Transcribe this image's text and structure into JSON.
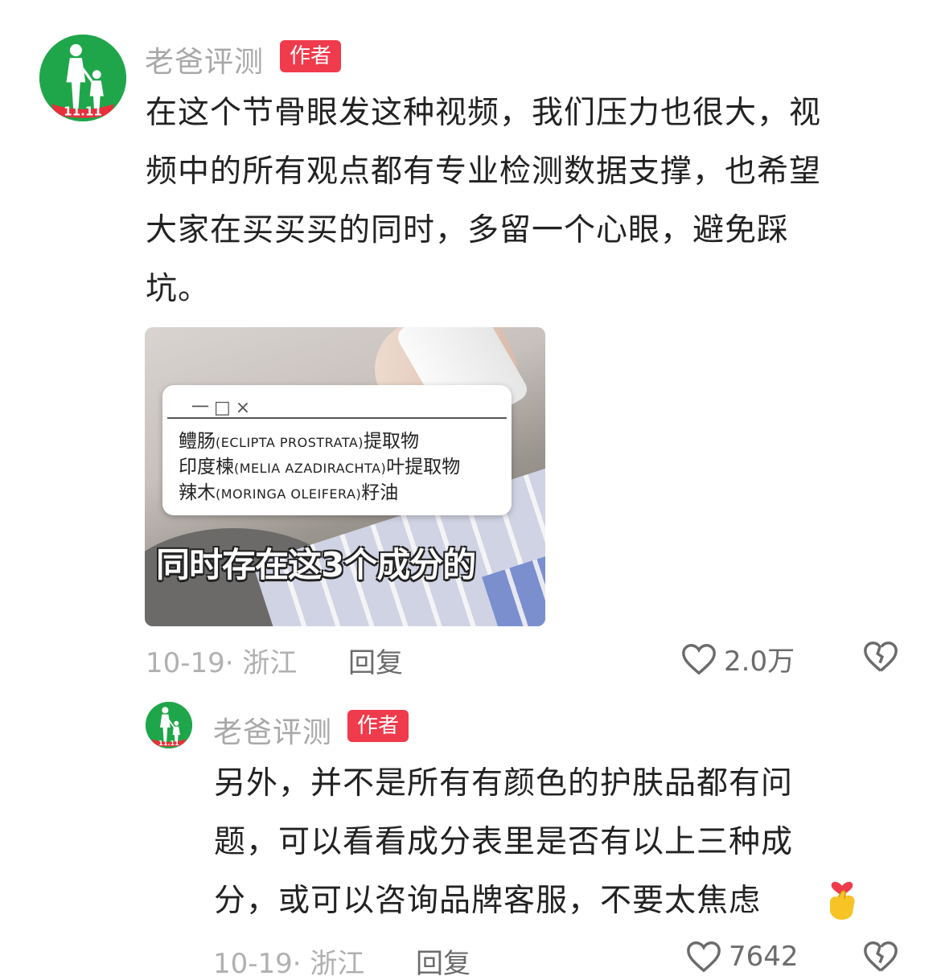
{
  "comment": {
    "username": "老爸评测",
    "badge": "作者",
    "avatar_badge": "11.11",
    "text_lines": [
      "在这个节骨眼发这种视频，我们压力也很大，视",
      "频中的所有观点都有专业检测数据支撑，也希望",
      "大家在买买买的同时，多留一个心眼，避免踩",
      "坑。"
    ],
    "image": {
      "window_controls": "一□×",
      "ingredients": [
        {
          "cn": "鳢肠",
          "latin": "(ECLIPTA PROSTRATA)",
          "suffix": "提取物"
        },
        {
          "cn": "印度楝",
          "latin": "(MELIA AZADIRACHTA)",
          "suffix": "叶提取物"
        },
        {
          "cn": "辣木",
          "latin": "(MORINGA OLEIFERA)",
          "suffix": "籽油"
        }
      ],
      "caption": "同时存在这3个成分的"
    },
    "date_location": "10-19· 浙江",
    "reply_label": "回复",
    "likes": "2.0万"
  },
  "reply": {
    "username": "老爸评测",
    "badge": "作者",
    "avatar_badge": "11.11",
    "text_lines": [
      "另外，并不是所有有颜色的护肤品都有问",
      "题，可以看看成分表里是否有以上三种成",
      "分，或可以咨询品牌客服，不要太焦虑"
    ],
    "emoji": "finger-heart-emoji",
    "date_location": "10-19· 浙江",
    "reply_label": "回复",
    "likes": "7642"
  },
  "colors": {
    "avatar_green": "#1fa64a",
    "badge_red": "#ef3b4c",
    "meta_gray": "#b0b0b0"
  }
}
